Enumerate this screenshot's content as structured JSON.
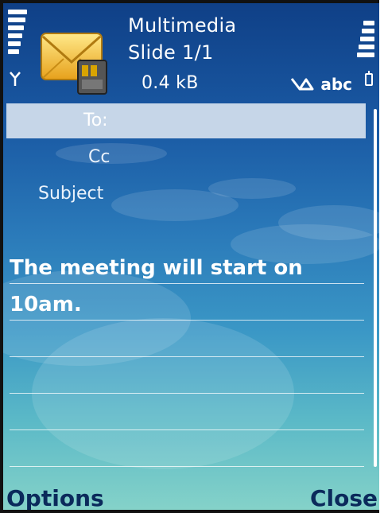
{
  "header": {
    "title": "Multimedia",
    "slide": "Slide 1/1",
    "size": "0.4 kB",
    "input_mode": "abc"
  },
  "fields": {
    "to_label": "To:",
    "cc_label": "Cc",
    "subject_label": "Subject"
  },
  "message": {
    "line1": "The meeting will start on",
    "line2": "10am."
  },
  "softkeys": {
    "left": "Options",
    "right": "Close"
  },
  "colors": {
    "accent": "#1a5aa4",
    "highlight": "#c6d6e8",
    "softkey_text": "#0b2a5b"
  },
  "icons": [
    "signal-strength-icon",
    "antenna-icon",
    "mms-envelope-icon",
    "predictive-text-icon",
    "battery-level-icon",
    "battery-icon"
  ]
}
